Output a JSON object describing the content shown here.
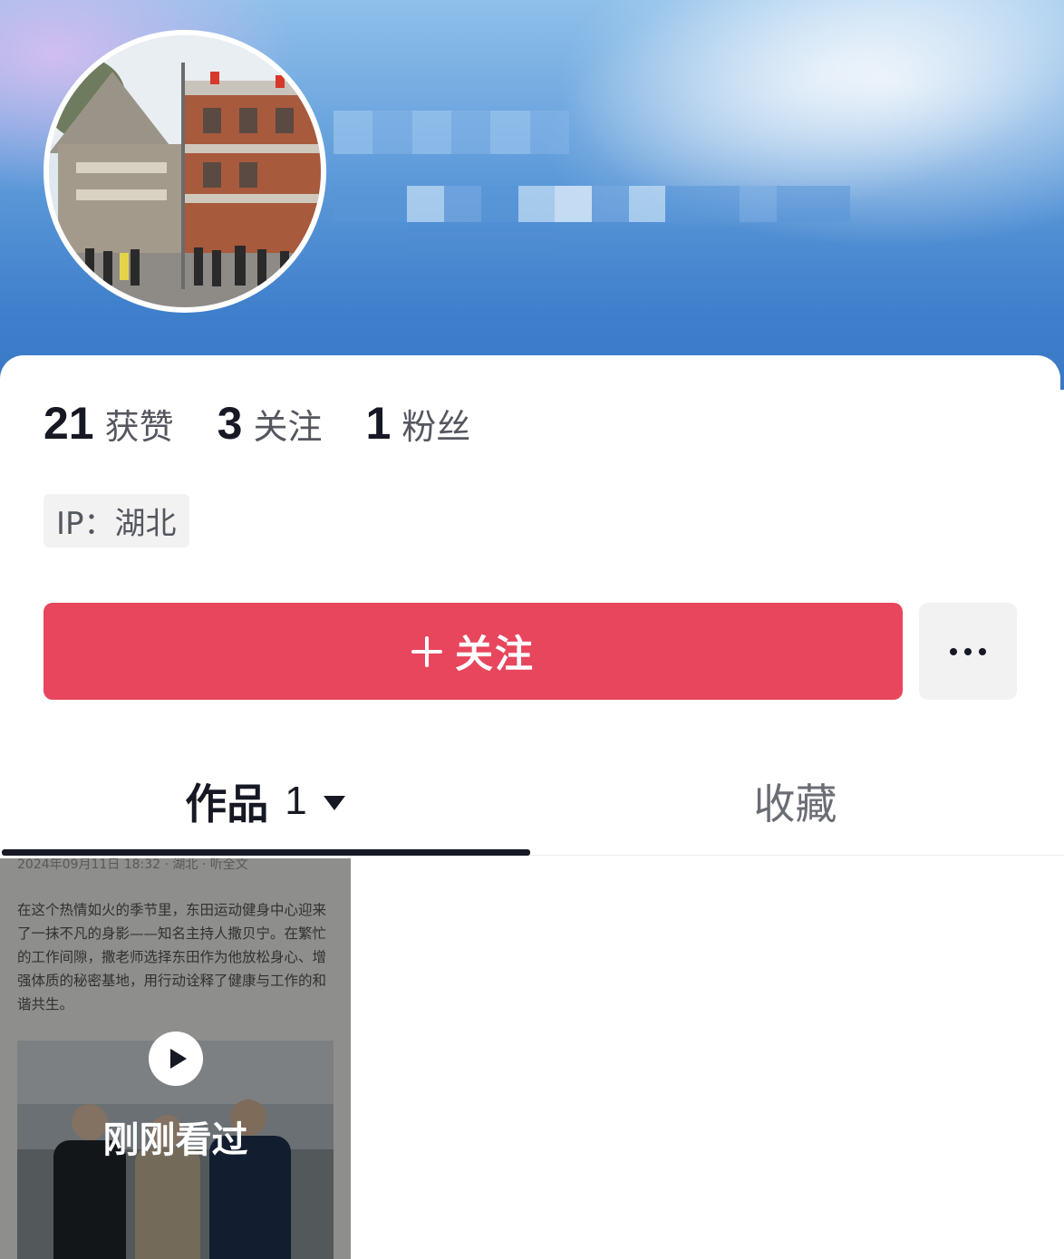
{
  "profile": {
    "likes_count": "21",
    "likes_label": "获赞",
    "following_count": "3",
    "following_label": "关注",
    "followers_count": "1",
    "followers_label": "粉丝",
    "ip_text": "IP：湖北"
  },
  "actions": {
    "follow_label": "关注",
    "more_icon": "ellipsis-icon"
  },
  "tabs": [
    {
      "label": "作品",
      "count": "1",
      "active": true
    },
    {
      "label": "收藏",
      "active": false
    }
  ],
  "video": {
    "meta": "2024年09月11日 18:32 · 湖北 · 听全文",
    "excerpt": "在这个热情如火的季节里，东田运动健身中心迎来了一抹不凡的身影——知名主持人撒贝宁。在繁忙的工作间隙，撒老师选择东田作为他放松身心、增强体质的秘密基地，用行动诠释了健康与工作的和谐共生。",
    "overlay_label": "刚刚看过"
  },
  "colors": {
    "follow_button": "#e8465d",
    "header_blue": "#3f7fcb",
    "text_primary": "#161823"
  }
}
